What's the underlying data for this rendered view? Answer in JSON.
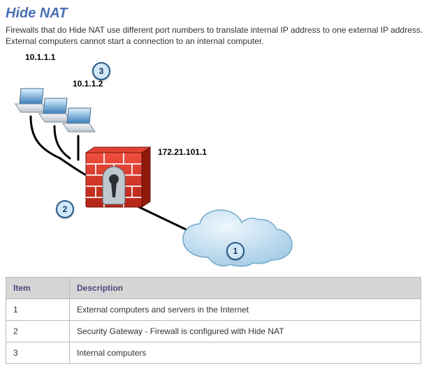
{
  "title": "Hide NAT",
  "description": "Firewalls that do Hide NAT use different port numbers to translate internal IP address to one external IP address. External computers cannot start a connection to an internal computer.",
  "diagram": {
    "ip_internal_1": "10.1.1.1",
    "ip_internal_2": "10.1.1.2",
    "ip_external": "172.21.101.1",
    "badge_cloud": "1",
    "badge_firewall": "2",
    "badge_internal": "3"
  },
  "table": {
    "head_item": "Item",
    "head_desc": "Description",
    "rows": [
      {
        "item": "1",
        "desc": "External computers and servers in the Internet"
      },
      {
        "item": "2",
        "desc": "Security Gateway - Firewall is configured with Hide NAT"
      },
      {
        "item": "3",
        "desc": "Internal computers"
      }
    ]
  }
}
